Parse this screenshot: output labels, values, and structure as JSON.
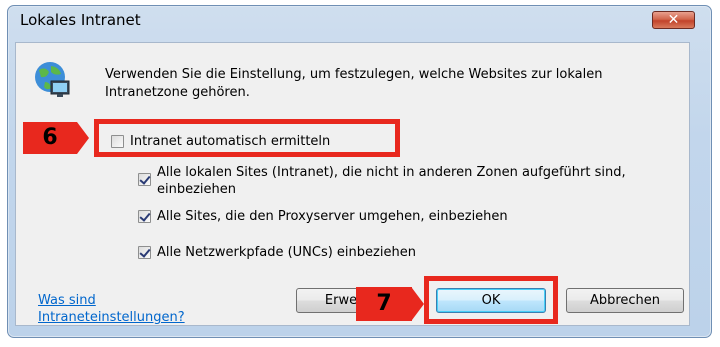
{
  "window": {
    "title": "Lokales Intranet",
    "close_symbol": "✕"
  },
  "description": "Verwenden Sie die Einstellung, um festzulegen, welche Websites zur lokalen Intranetzone gehören.",
  "options": {
    "auto_detect": {
      "label": "Intranet automatisch ermitteln",
      "checked": false
    },
    "local_sites": {
      "label": "Alle lokalen Sites (Intranet), die nicht in anderen Zonen aufgeführt sind, einbeziehen",
      "checked": true
    },
    "proxy_bypass": {
      "label": "Alle Sites, die den Proxyserver umgehen, einbeziehen",
      "checked": true
    },
    "unc_paths": {
      "label": "Alle Netzwerkpfade (UNCs) einbeziehen",
      "checked": true
    }
  },
  "help_link": {
    "line1": "Was sind",
    "line2": "Intraneteinstellungen?"
  },
  "buttons": {
    "advanced": "Erwe",
    "ok": "OK",
    "cancel": "Abbrechen"
  },
  "annotations": {
    "step6": "6",
    "step7": "7"
  },
  "colors": {
    "highlight": "#e8281e",
    "link": "#0066cc"
  }
}
